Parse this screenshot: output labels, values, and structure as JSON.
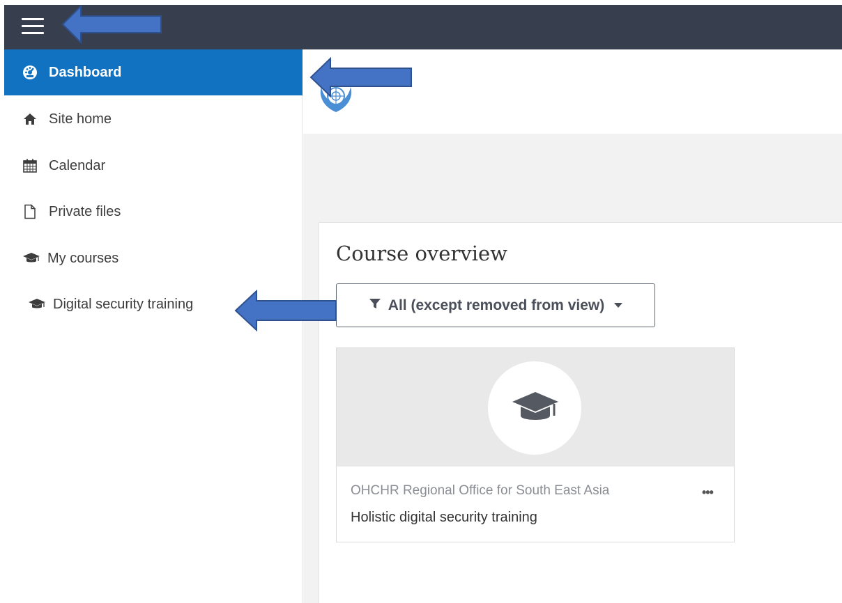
{
  "navbar": {
    "menu_toggle": "menu-toggle"
  },
  "sidebar": {
    "items": [
      {
        "label": "Dashboard",
        "icon": "dashboard-icon",
        "active": true
      },
      {
        "label": "Site home",
        "icon": "home-icon"
      },
      {
        "label": "Calendar",
        "icon": "calendar-icon"
      },
      {
        "label": "Private files",
        "icon": "file-icon"
      },
      {
        "label": "My courses",
        "icon": "graduation-cap-icon"
      },
      {
        "label": "Digital security training",
        "icon": "graduation-cap-icon"
      }
    ]
  },
  "main": {
    "course_overview_title": "Course overview",
    "filter_label": "All (except removed from view)",
    "course_card": {
      "category": "OHCHR Regional Office for South East Asia",
      "name": "Holistic digital security training",
      "menu": "•••"
    }
  },
  "colors": {
    "navbar": "#373f4f",
    "active_item": "#1072c1",
    "annotation_arrow": "#4472c4"
  }
}
